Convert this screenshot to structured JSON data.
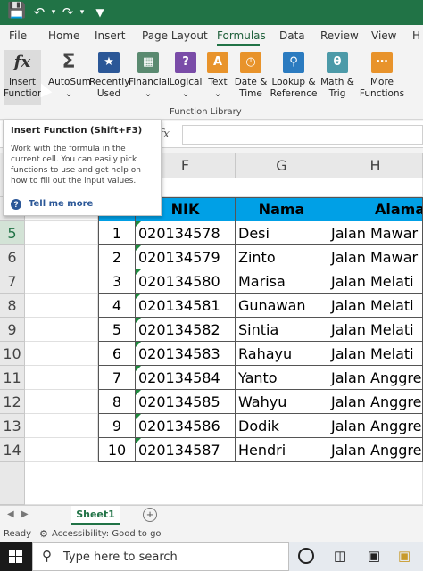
{
  "menu": {
    "tabs": [
      "File",
      "Home",
      "Insert",
      "Page Layout",
      "Formulas",
      "Data",
      "Review",
      "View",
      "H"
    ]
  },
  "ribbon": {
    "insert_function": [
      "Insert",
      "Function"
    ],
    "autosum": [
      "AutoSum",
      ""
    ],
    "recently_used": [
      "Recently",
      "Used"
    ],
    "financial": [
      "Financial",
      ""
    ],
    "logical": [
      "Logical",
      ""
    ],
    "text": [
      "Text",
      ""
    ],
    "date_time": [
      "Date &",
      "Time"
    ],
    "lookup": [
      "Lookup &",
      "Reference"
    ],
    "math": [
      "Math &",
      "Trig"
    ],
    "more": [
      "More",
      "Functions"
    ],
    "group_label": "Function Library"
  },
  "tooltip": {
    "title": "Insert Function (Shift+F3)",
    "body": "Work with the formula in the current cell. You can easily pick functions to use and get help on how to fill out the input values.",
    "tell_me": "Tell me more"
  },
  "formula_bar": {
    "fx": "fx"
  },
  "columns": [
    "F",
    "G",
    "H"
  ],
  "table": {
    "headers": [
      "NIK",
      "Nama",
      "Alama"
    ],
    "rows": [
      {
        "row": "5",
        "no": "1",
        "nik": "020134578",
        "nama": "Desi",
        "alamat": "Jalan Mawar"
      },
      {
        "row": "6",
        "no": "2",
        "nik": "020134579",
        "nama": "Zinto",
        "alamat": "Jalan Mawar"
      },
      {
        "row": "7",
        "no": "3",
        "nik": "020134580",
        "nama": "Marisa",
        "alamat": "Jalan Melati"
      },
      {
        "row": "8",
        "no": "4",
        "nik": "020134581",
        "nama": "Gunawan",
        "alamat": "Jalan Melati"
      },
      {
        "row": "9",
        "no": "5",
        "nik": "020134582",
        "nama": "Sintia",
        "alamat": "Jalan Melati"
      },
      {
        "row": "10",
        "no": "6",
        "nik": "020134583",
        "nama": "Rahayu",
        "alamat": "Jalan Melati"
      },
      {
        "row": "11",
        "no": "7",
        "nik": "020134584",
        "nama": "Yanto",
        "alamat": "Jalan Anggre"
      },
      {
        "row": "12",
        "no": "8",
        "nik": "020134585",
        "nama": "Wahyu",
        "alamat": "Jalan Anggre"
      },
      {
        "row": "13",
        "no": "9",
        "nik": "020134586",
        "nama": "Dodik",
        "alamat": "Jalan Anggre"
      },
      {
        "row": "14",
        "no": "10",
        "nik": "020134587",
        "nama": "Hendri",
        "alamat": "Jalan Anggre"
      }
    ]
  },
  "sheet": {
    "tab": "Sheet1",
    "add": "+"
  },
  "status": {
    "ready": "Ready",
    "accessibility": "Accessibility: Good to go"
  },
  "taskbar": {
    "search_placeholder": "Type here to search"
  },
  "colors": {
    "excel_green": "#217346",
    "header_blue": "#00a0e6"
  }
}
